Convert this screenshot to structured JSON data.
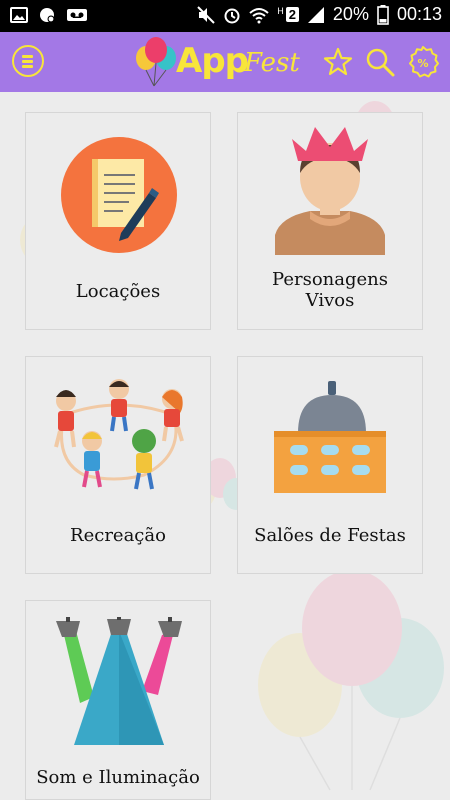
{
  "status_bar": {
    "battery_percent": "20%",
    "time": "00:13",
    "sim_label": "H",
    "sim_number": "2"
  },
  "app_bar": {
    "logo_app": "App",
    "logo_fest": "Fest",
    "accent_color": "#a378e6",
    "icon_color": "#f8e53a"
  },
  "categories": [
    {
      "label": "Locações",
      "icon": "document-pen-icon"
    },
    {
      "label_line1": "Personagens",
      "label_line2": "Vivos",
      "icon": "character-person-icon"
    },
    {
      "label": "Recreação",
      "icon": "children-playing-icon"
    },
    {
      "label": "Salões de Festas",
      "icon": "party-hall-icon"
    },
    {
      "label": "Som e Iluminação",
      "icon": "stage-lights-icon"
    }
  ]
}
